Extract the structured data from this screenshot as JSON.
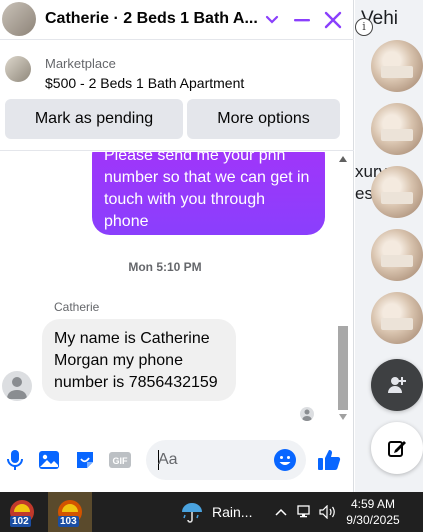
{
  "background_page": {
    "partial_texts": [
      "Vehi",
      "xury",
      "est"
    ]
  },
  "chat": {
    "title": "Catherie · 2 Beds 1 Bath A...",
    "listing": {
      "label": "Marketplace",
      "description": "$500 - 2 Beds 1 Bath Apartment",
      "mark_pending_label": "Mark as pending",
      "more_options_label": "More options"
    },
    "messages": {
      "outgoing_text": "Please send me your phn number so that we can get in touch with you through phone",
      "timestamp": "Mon 5:10 PM",
      "sender_name": "Catherie",
      "incoming_text": "My name is Catherine Morgan my phone number is 7856432159"
    },
    "composer": {
      "placeholder": "Aa"
    }
  },
  "taskbar": {
    "app1_badge": "102",
    "app2_badge": "103",
    "weather_text": "Rain...",
    "time": "4:59 AM",
    "date": "9/30/2025"
  },
  "colors": {
    "messenger_blue": "#0866ff",
    "close_purple": "#8a3ffc",
    "outgoing_bubble": "#a334fa"
  }
}
